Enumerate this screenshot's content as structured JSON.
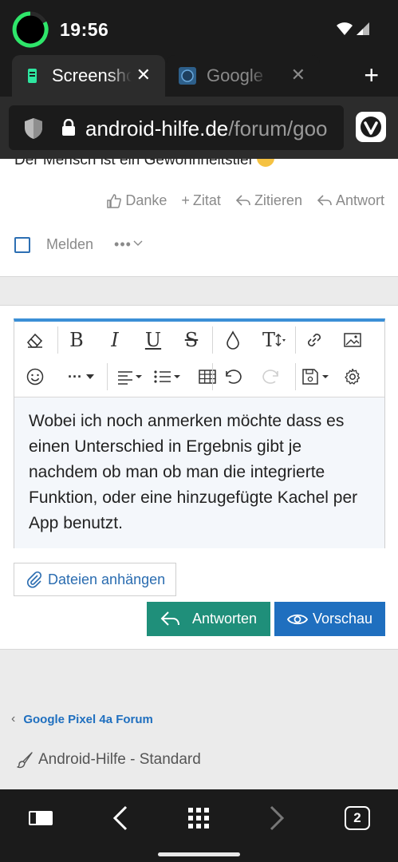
{
  "status": {
    "time": "19:56"
  },
  "tabs": [
    {
      "title": "Screenshot",
      "active": true
    },
    {
      "title": "Google Pixel",
      "active": false
    }
  ],
  "address": {
    "domain": "android-hilfe.de",
    "path": "/forum/goo"
  },
  "post": {
    "partial_text": "Der Mensch ist ein Gewohnheitstier",
    "actions": [
      "Danke",
      "Zitat",
      "Zitieren",
      "Antwort"
    ],
    "report_label": "Melden",
    "more_label": "•••"
  },
  "editor": {
    "toolbar_row1": [
      "eraser-icon",
      "bold-icon",
      "italic-icon",
      "underline-icon",
      "strikethrough-icon",
      "color-icon",
      "text-size-icon",
      "link-icon",
      "image-icon"
    ],
    "toolbar_row2": [
      "emoji-icon",
      "more-icon",
      "align-icon",
      "list-icon",
      "table-icon",
      "undo-icon",
      "redo-icon",
      "save-icon",
      "settings-icon"
    ],
    "bold_glyph": "B",
    "italic_glyph": "I",
    "underline_glyph": "U",
    "strike_glyph": "S",
    "text_size_glyph": "T",
    "more_glyph": "···",
    "body_text": "Wobei ich noch anmerken möchte dass es einen Unterschied in Ergebnis gibt je nachdem ob man ob man die integrierte Funktion, oder eine hinzugefügte Kachel per App benutzt."
  },
  "buttons": {
    "attach": "Dateien anhängen",
    "reply": "Antworten",
    "preview": "Vorschau"
  },
  "breadcrumb": {
    "forum": "Google Pixel 4a Forum"
  },
  "style_chooser": {
    "label": "Android-Hilfe - Standard"
  },
  "bottom_nav": {
    "tab_count": "2"
  },
  "colors": {
    "accent_teal": "#1f8f7a",
    "accent_blue": "#1f6fbf",
    "editor_top": "#3b8fd6",
    "chrome_dark": "#1b1b1b"
  }
}
